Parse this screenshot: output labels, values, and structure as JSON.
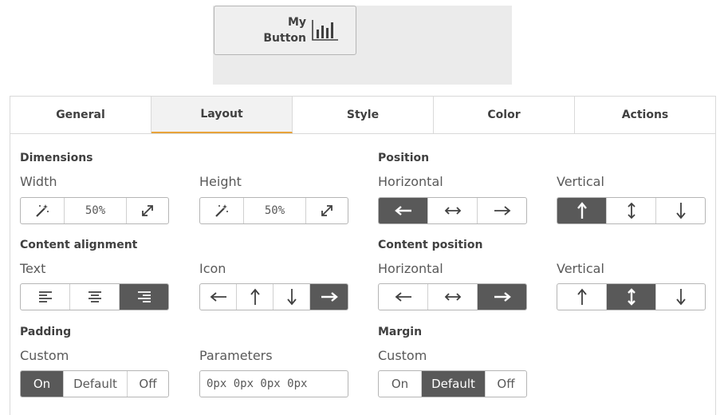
{
  "preview": {
    "button_label_line1": "My",
    "button_label_line2": "Button",
    "icon": "bar-chart-icon"
  },
  "tabs": [
    {
      "label": "General",
      "active": false
    },
    {
      "label": "Layout",
      "active": true
    },
    {
      "label": "Style",
      "active": false
    },
    {
      "label": "Color",
      "active": false
    },
    {
      "label": "Actions",
      "active": false
    }
  ],
  "dimensions": {
    "title": "Dimensions",
    "width": {
      "label": "Width",
      "value": "50%"
    },
    "height": {
      "label": "Height",
      "value": "50%"
    }
  },
  "position": {
    "title": "Position",
    "horizontal": {
      "label": "Horizontal",
      "selected": "left"
    },
    "vertical": {
      "label": "Vertical",
      "selected": "top"
    }
  },
  "content_alignment": {
    "title": "Content alignment",
    "text": {
      "label": "Text",
      "selected": "right"
    },
    "icon": {
      "label": "Icon",
      "selected": "right"
    }
  },
  "content_position": {
    "title": "Content position",
    "horizontal": {
      "label": "Horizontal",
      "selected": "right"
    },
    "vertical": {
      "label": "Vertical",
      "selected": "center"
    }
  },
  "padding": {
    "title": "Padding",
    "custom_label": "Custom",
    "options": [
      "On",
      "Default",
      "Off"
    ],
    "selected": "On",
    "parameters_label": "Parameters",
    "parameters_placeholder": "0px 0px 0px 0px"
  },
  "margin": {
    "title": "Margin",
    "custom_label": "Custom",
    "options": [
      "On",
      "Default",
      "Off"
    ],
    "selected": "Default"
  },
  "colors": {
    "selected_bg": "#595959",
    "active_tab_underline": "#e8a33a",
    "preview_bg": "#ebebeb"
  }
}
